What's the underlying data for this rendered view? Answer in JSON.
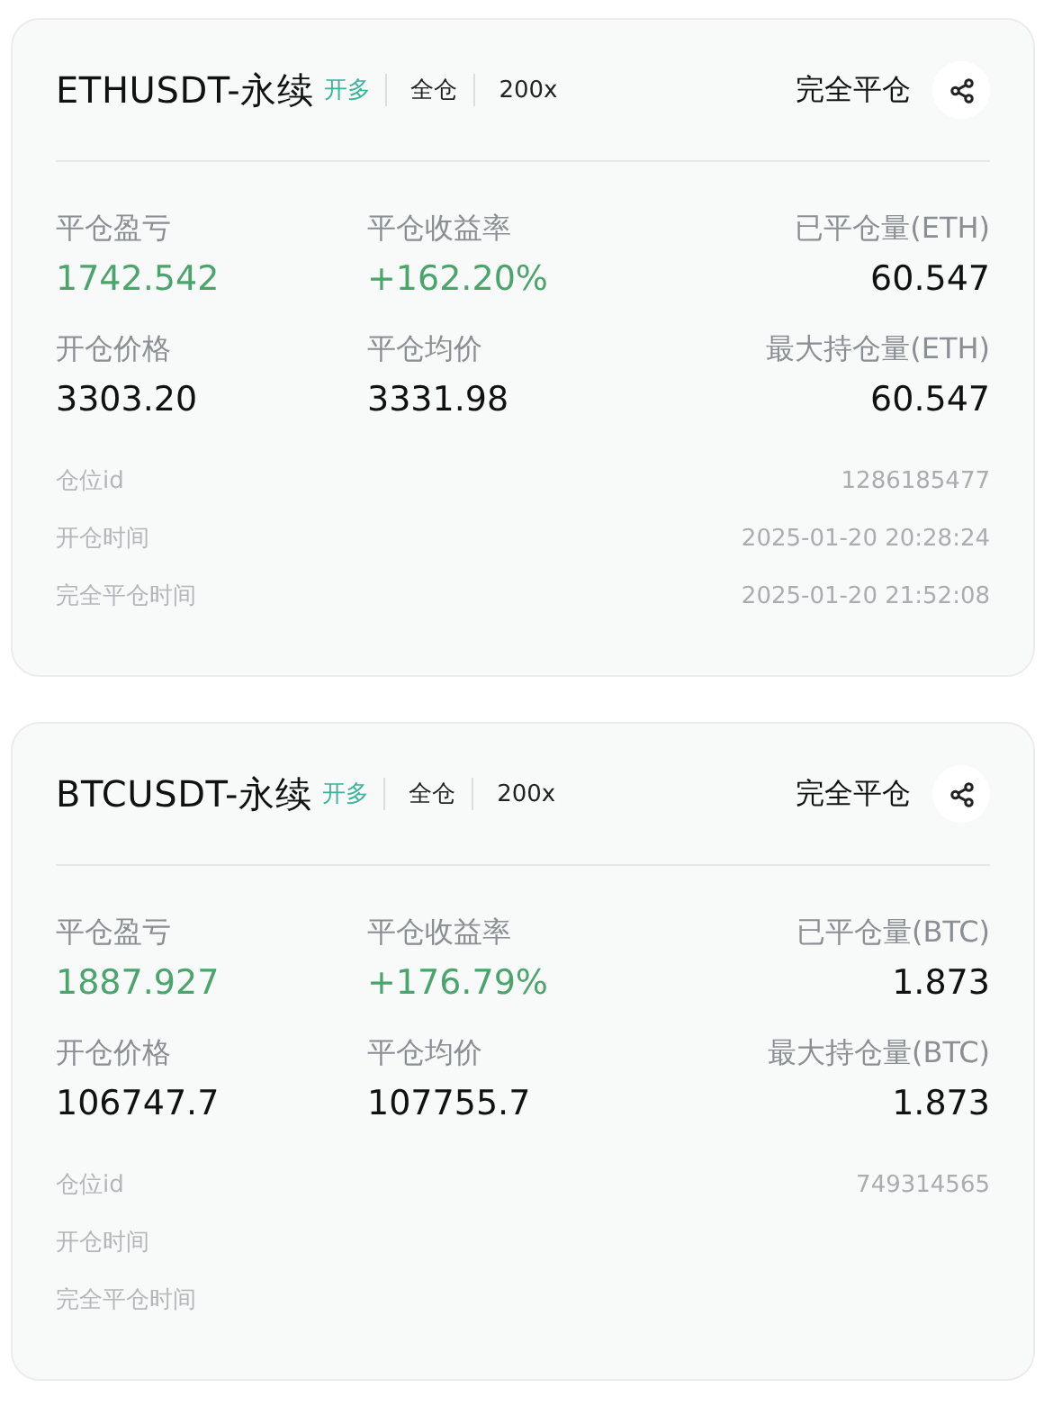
{
  "positions": [
    {
      "symbol": "ETHUSDT-永续",
      "side": "开多",
      "margin_mode": "全仓",
      "leverage": "200x",
      "status": "完全平仓",
      "stats": [
        {
          "label": "平仓盈亏",
          "value": "1742.542",
          "positive": true
        },
        {
          "label": "平仓收益率",
          "value": "+162.20%",
          "positive": true
        },
        {
          "label": "已平仓量(ETH)",
          "value": "60.547",
          "positive": false
        },
        {
          "label": "开仓价格",
          "value": "3303.20",
          "positive": false
        },
        {
          "label": "平仓均价",
          "value": "3331.98",
          "positive": false
        },
        {
          "label": "最大持仓量(ETH)",
          "value": "60.547",
          "positive": false
        }
      ],
      "details": [
        {
          "label": "仓位id",
          "value": "1286185477"
        },
        {
          "label": "开仓时间",
          "value": "2025-01-20 20:28:24"
        },
        {
          "label": "完全平仓时间",
          "value": "2025-01-20 21:52:08"
        }
      ]
    },
    {
      "symbol": "BTCUSDT-永续",
      "side": "开多",
      "margin_mode": "全仓",
      "leverage": "200x",
      "status": "完全平仓",
      "stats": [
        {
          "label": "平仓盈亏",
          "value": "1887.927",
          "positive": true
        },
        {
          "label": "平仓收益率",
          "value": "+176.79%",
          "positive": true
        },
        {
          "label": "已平仓量(BTC)",
          "value": "1.873",
          "positive": false
        },
        {
          "label": "开仓价格",
          "value": "106747.7",
          "positive": false
        },
        {
          "label": "平仓均价",
          "value": "107755.7",
          "positive": false
        },
        {
          "label": "最大持仓量(BTC)",
          "value": "1.873",
          "positive": false
        }
      ],
      "details": [
        {
          "label": "仓位id",
          "value": "749314565"
        },
        {
          "label": "开仓时间"
        },
        {
          "label": "完全平仓时间"
        }
      ]
    }
  ]
}
